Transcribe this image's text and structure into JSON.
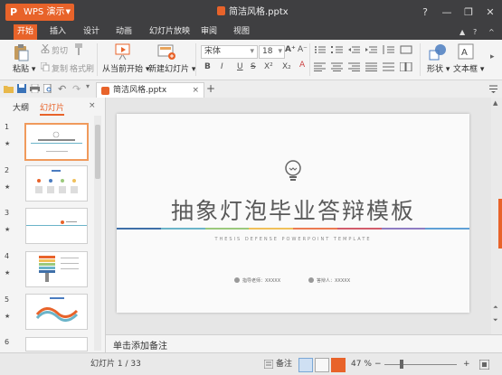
{
  "app": {
    "name": "WPS 演示",
    "logo_letter": "P",
    "document_title": "简洁风格.pptx",
    "window_controls": [
      "?",
      "—",
      "❐",
      "✕"
    ]
  },
  "menu": {
    "items": [
      "开始",
      "插入",
      "设计",
      "动画",
      "幻灯片放映",
      "审阅",
      "视图"
    ],
    "active_index": 0,
    "right_icons": [
      "▲",
      "?",
      "^"
    ]
  },
  "ribbon": {
    "paste": "粘贴",
    "cut": "剪切",
    "copy": "复制",
    "format_painter": "格式刷",
    "from_current": "从当前开始",
    "new_slide": "新建幻灯片",
    "font_name": "宋体",
    "font_size": "18",
    "bold": "B",
    "italic": "I",
    "underline": "U",
    "strike": "S",
    "superscript": "X²",
    "subscript": "X₂",
    "shape": "形状",
    "textbox": "文本框",
    "font_grow": "A⁺",
    "font_shrink": "A⁻"
  },
  "quick_access": [
    "open-folder",
    "save",
    "print",
    "preview",
    "undo",
    "redo"
  ],
  "tabs": {
    "doc_tab": "简洁风格.pptx",
    "close": "×",
    "add": "+"
  },
  "left_panel": {
    "tab_outline": "大纲",
    "tab_slides": "幻灯片",
    "slide_numbers": [
      "1",
      "2",
      "3",
      "4",
      "5",
      "6"
    ],
    "selected_index": 0
  },
  "slide": {
    "title": "抽象灯泡毕业答辩模板",
    "subtitle": "THESIS DEFENSE POWERPOINT TEMPLATE",
    "advisor": "指导老师：XXXXX",
    "presenter": "答辩人：XXXXX",
    "stripe_colors": [
      "#3e6fa8",
      "#6bb4c9",
      "#9bc97c",
      "#f0c05a",
      "#ec7b52",
      "#d25c6b",
      "#8e7cc3",
      "#5fa0d6"
    ]
  },
  "notes": {
    "placeholder": "单击添加备注"
  },
  "status": {
    "slide_counter": "幻灯片 1 / 33",
    "notes_btn": "备注",
    "zoom": "47 %",
    "zoom_value": 0.47
  },
  "colors": {
    "accent": "#e8632a",
    "titlebar": "#3f3f41"
  }
}
